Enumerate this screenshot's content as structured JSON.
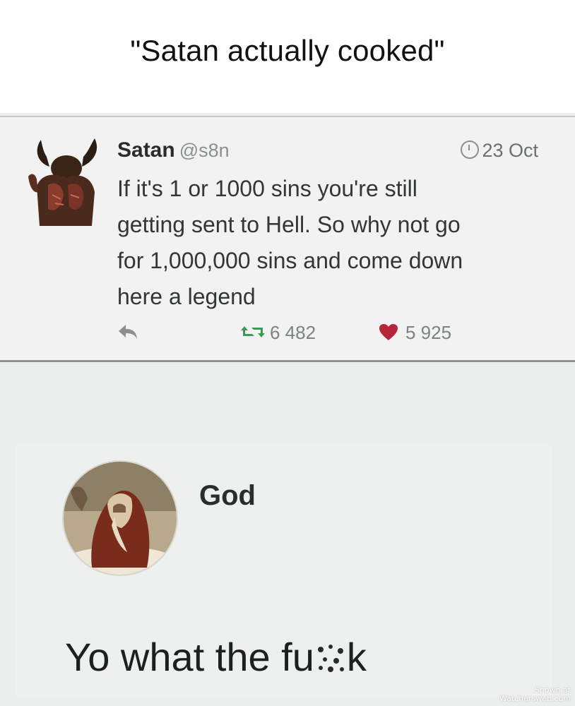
{
  "caption": "\"Satan actually cooked\"",
  "tweet": {
    "display_name": "Satan",
    "handle": "@s8n",
    "timestamp": "23 Oct",
    "text_lines": [
      "If it's 1 or 1000 sins you're still",
      "getting sent to Hell. So why not go",
      "for 1,000,000 sins and come down",
      "here a legend"
    ],
    "retweets": "6 482",
    "likes": "5 925",
    "icons": [
      "clock-icon",
      "reply-icon",
      "retweet-icon",
      "heart-icon"
    ]
  },
  "reply": {
    "display_name": "God",
    "text_before_censor": "Yo what the fu",
    "text_after_censor": "k"
  },
  "watermark": {
    "line1": "Shown at",
    "line2": "Watchersweb.com"
  },
  "colors": {
    "like_heart": "#b8243a",
    "retweet_green": "#3d9a52",
    "background": "#eceeed"
  }
}
